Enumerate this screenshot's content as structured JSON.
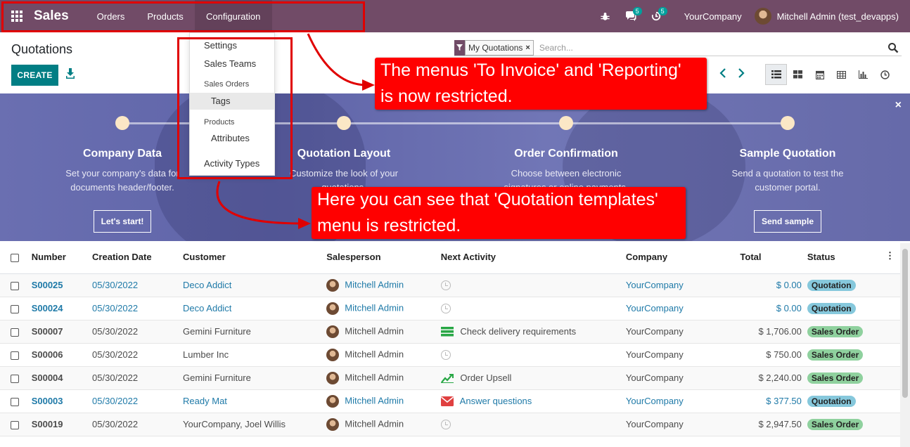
{
  "navbar": {
    "app_name": "Sales",
    "menu": [
      "Orders",
      "Products",
      "Configuration"
    ],
    "chat_count": "5",
    "activity_count": "5",
    "company": "YourCompany",
    "user": "Mitchell Admin (test_devapps)"
  },
  "dropdown": {
    "settings": "Settings",
    "sales_teams": "Sales Teams",
    "sales_orders_header": "Sales Orders",
    "tags": "Tags",
    "products_header": "Products",
    "attributes": "Attributes",
    "activity_types": "Activity Types"
  },
  "control_panel": {
    "title": "Quotations",
    "create_label": "CREATE",
    "facet": "My Quotations",
    "search_placeholder": "Search..."
  },
  "banner": {
    "steps": [
      {
        "title": "Company Data",
        "desc1": "Set your company's data for",
        "desc2": "documents header/footer.",
        "button": "Let's start!"
      },
      {
        "title": "Quotation Layout",
        "desc1": "Customize the look of your",
        "desc2": "quotations."
      },
      {
        "title": "Order Confirmation",
        "desc1": "Choose between electronic",
        "desc2": "signatures or online payments."
      },
      {
        "title": "Sample Quotation",
        "desc1": "Send a quotation to test the",
        "desc2": "customer portal.",
        "button": "Send sample"
      }
    ]
  },
  "callouts": {
    "top_line1": "The menus 'To Invoice' and 'Reporting'",
    "top_line2": "is now restricted.",
    "bottom_line1": "Here you can see that 'Quotation templates'",
    "bottom_line2": "menu is restricted."
  },
  "table": {
    "headers": {
      "number": "Number",
      "creation_date": "Creation Date",
      "customer": "Customer",
      "salesperson": "Salesperson",
      "next_activity": "Next Activity",
      "company": "Company",
      "total": "Total",
      "status": "Status"
    },
    "rows": [
      {
        "number": "S00025",
        "date": "05/30/2022",
        "customer": "Deco Addict",
        "salesperson": "Mitchell Admin",
        "activity": "",
        "company": "YourCompany",
        "total": "$ 0.00",
        "status": "Quotation"
      },
      {
        "number": "S00024",
        "date": "05/30/2022",
        "customer": "Deco Addict",
        "salesperson": "Mitchell Admin",
        "activity": "",
        "company": "YourCompany",
        "total": "$ 0.00",
        "status": "Quotation"
      },
      {
        "number": "S00007",
        "date": "05/30/2022",
        "customer": "Gemini Furniture",
        "salesperson": "Mitchell Admin",
        "activity": "Check delivery requirements",
        "company": "YourCompany",
        "total": "$ 1,706.00",
        "status": "Sales Order"
      },
      {
        "number": "S00006",
        "date": "05/30/2022",
        "customer": "Lumber Inc",
        "salesperson": "Mitchell Admin",
        "activity": "",
        "company": "YourCompany",
        "total": "$ 750.00",
        "status": "Sales Order"
      },
      {
        "number": "S00004",
        "date": "05/30/2022",
        "customer": "Gemini Furniture",
        "salesperson": "Mitchell Admin",
        "activity": "Order Upsell",
        "company": "YourCompany",
        "total": "$ 2,240.00",
        "status": "Sales Order"
      },
      {
        "number": "S00003",
        "date": "05/30/2022",
        "customer": "Ready Mat",
        "salesperson": "Mitchell Admin",
        "activity": "Answer questions",
        "company": "YourCompany",
        "total": "$ 377.50",
        "status": "Quotation"
      },
      {
        "number": "S00019",
        "date": "05/30/2022",
        "customer": "YourCompany, Joel Willis",
        "salesperson": "Mitchell Admin",
        "activity": "",
        "company": "YourCompany",
        "total": "$ 2,947.50",
        "status": "Sales Order"
      }
    ]
  },
  "colors": {
    "navbar": "#714b67",
    "primary": "#017e84",
    "link": "#1f7aa8",
    "callout": "#ff0000"
  }
}
